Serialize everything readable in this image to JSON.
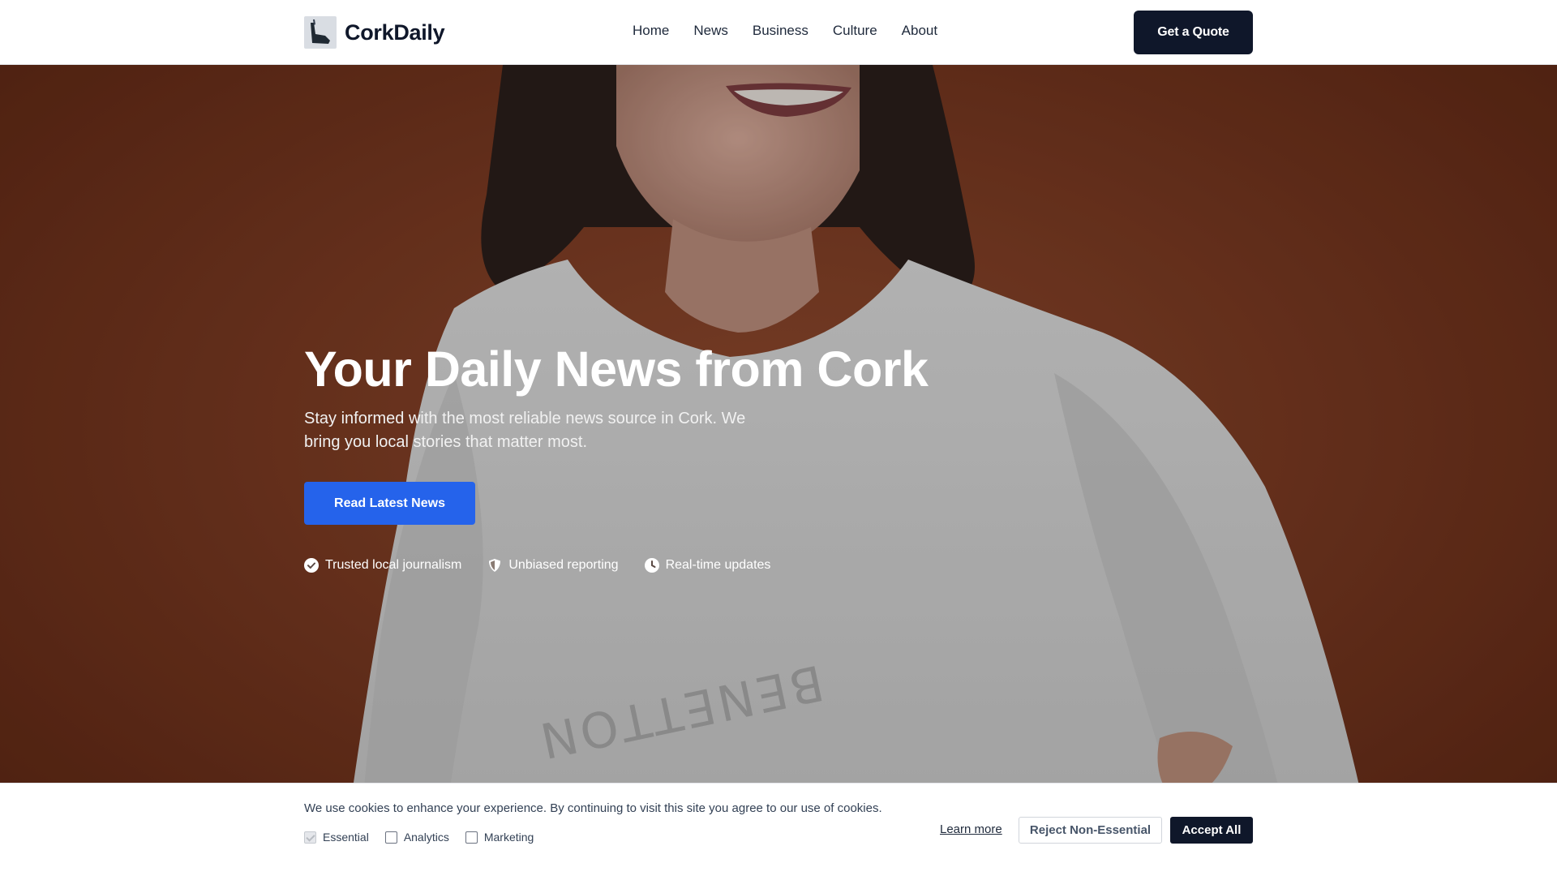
{
  "header": {
    "brand": "CorkDaily",
    "nav": [
      "Home",
      "News",
      "Business",
      "Culture",
      "About"
    ],
    "quote_label": "Get a Quote"
  },
  "hero": {
    "title": "Your Daily News from Cork",
    "subtitle": "Stay informed with the most reliable news source in Cork. We bring you local stories that matter most.",
    "cta_label": "Read Latest News",
    "features": [
      {
        "icon": "check-circle-icon",
        "label": "Trusted local journalism"
      },
      {
        "icon": "shield-icon",
        "label": "Unbiased reporting"
      },
      {
        "icon": "clock-icon",
        "label": "Real-time updates"
      }
    ],
    "shirt_text": "BENETTON"
  },
  "cookie": {
    "message": "We use cookies to enhance your experience. By continuing to visit this site you agree to our use of cookies.",
    "options": [
      {
        "label": "Essential",
        "checked": true,
        "disabled": true
      },
      {
        "label": "Analytics",
        "checked": false
      },
      {
        "label": "Marketing",
        "checked": false
      }
    ],
    "learn_more": "Learn more",
    "reject_label": "Reject Non-Essential",
    "accept_label": "Accept All"
  },
  "colors": {
    "primary": "#2563eb",
    "dark": "#0f172a",
    "hero_bg": "#7a3a22"
  }
}
